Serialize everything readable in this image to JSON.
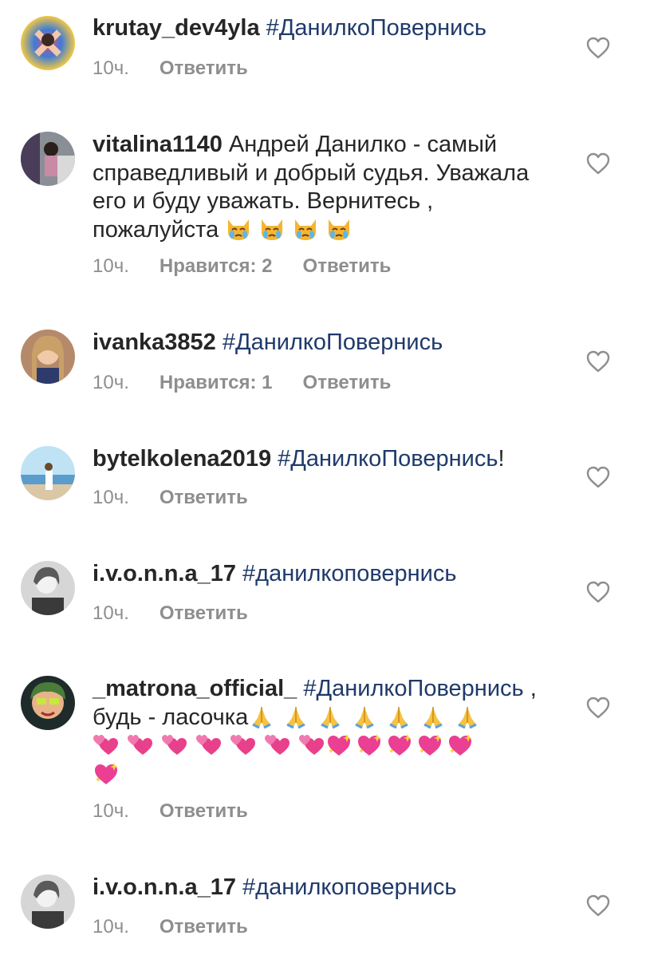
{
  "comments": [
    {
      "username": "krutay_dev4yla",
      "hashtag": "#ДанилкоПовернись",
      "text": "",
      "time": "10ч.",
      "likes": "",
      "reply": "Ответить"
    },
    {
      "username": "vitalina1140",
      "hashtag": "",
      "text": "Андрей Данилко - самый справедливый и добрый судья. Уважала его и буду уважать. Вернитесь , пожалуйста",
      "emoji": [
        "crying-cat-emoji",
        "crying-cat-emoji",
        "crying-cat-emoji",
        "crying-cat-emoji"
      ],
      "time": "10ч.",
      "likes": "Нравится: 2",
      "reply": "Ответить"
    },
    {
      "username": "ivanka3852",
      "hashtag": "#ДанилкоПовернись",
      "text": "",
      "time": "10ч.",
      "likes": "Нравится: 1",
      "reply": "Ответить"
    },
    {
      "username": "bytelkolena2019",
      "hashtag": "#ДанилкоПовернись",
      "text": "!",
      "time": "10ч.",
      "likes": "",
      "reply": "Ответить"
    },
    {
      "username": "i.v.o.n.n.a_17",
      "hashtag": "#данилкоповернись",
      "text": "",
      "time": "10ч.",
      "likes": "",
      "reply": "Ответить"
    },
    {
      "username": "_matrona_official_",
      "hashtag": "#ДанилкоПовернись",
      "text": ", будь - ласочка",
      "emoji_groups": [
        "folded-hands-emoji x7",
        "revolving-hearts-emoji x7",
        "sparkling-heart-emoji x6"
      ],
      "time": "10ч.",
      "likes": "",
      "reply": "Ответить"
    },
    {
      "username": "i.v.o.n.n.a_17",
      "hashtag": "#данилкоповернись",
      "text": "",
      "time": "10ч.",
      "likes": "",
      "reply": "Ответить"
    }
  ],
  "colors": {
    "username": "#262626",
    "hashtag": "#1f3a6b",
    "meta": "#8e8e8e"
  },
  "icons": {
    "like": "heart-outline-icon"
  }
}
